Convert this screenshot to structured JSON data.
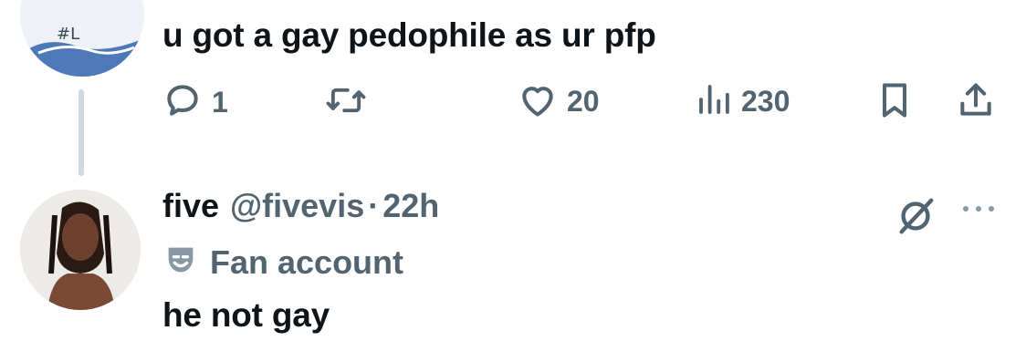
{
  "reply_tweet": {
    "text": "u got a gay pedophile as ur pfp",
    "avatar_icon": "avatar-image",
    "actions": {
      "reply_count": "1",
      "retweet_count": "",
      "like_count": "20",
      "view_count": "230"
    }
  },
  "response_tweet": {
    "display_name": "five",
    "handle": "@fivevis",
    "separator": "·",
    "time": "22h",
    "label": "Fan account",
    "label_icon": "theater-masks-icon",
    "text": "he not gay",
    "avatar_icon": "avatar-image"
  },
  "colors": {
    "text": "#0f1419",
    "secondary": "#536471",
    "thread_line": "#cfd9de"
  }
}
